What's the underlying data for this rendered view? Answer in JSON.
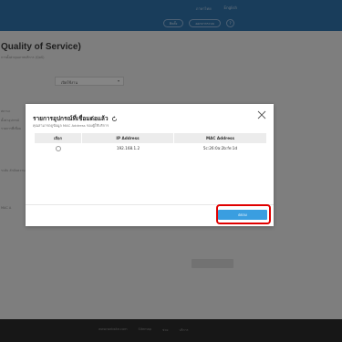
{
  "header": {
    "links": [
      "ภาษาไทย",
      "English"
    ],
    "buttons": [
      "ติดตั้ง",
      "ออกจากระบบ"
    ],
    "help": "?"
  },
  "page": {
    "title": "Quality of Service)",
    "subtitle": "การตั้งค่าคุณภาพบริการ (QoS)",
    "select_value": "เปิดใช้งาน",
    "labels": [
      "สถานะ",
      "ตั้งค่าอุปกรณ์",
      "รายการที่เชื่อม",
      "ระดับ  ลำดับความ",
      "MAC  A"
    ]
  },
  "modal": {
    "title": "รายการอุปกรณ์ที่เชื่อมต่อแล้ว",
    "subtitle": "คุณสามารถดูข้อมูล MAC Address ของผู้ใช้บริการ",
    "columns": [
      "เลือก",
      "IP Address",
      "MAC Address"
    ],
    "rows": [
      {
        "ip": "192.168.1.2",
        "mac": "5c:26:0a:2b:fe:1d"
      }
    ],
    "ok_label": "ตกลง"
  },
  "footer": {
    "links": [
      "www.website.com",
      "Sitemap",
      "ช่วย",
      "บริการ"
    ]
  },
  "colors": {
    "header": "#2f6fa6",
    "primary": "#3a9ee0",
    "highlight": "#e00000",
    "footer": "#2a2a2a"
  }
}
